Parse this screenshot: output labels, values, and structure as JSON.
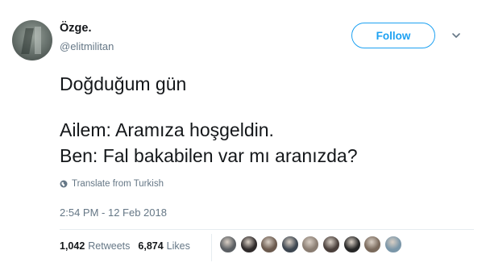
{
  "user": {
    "display_name": "Özge.",
    "handle": "@elitmilitan"
  },
  "follow_button": {
    "label": "Follow"
  },
  "tweet": {
    "lines": [
      "Doğduğum gün",
      "Ailem: Aramıza hoşgeldin.",
      "Ben: Fal bakabilen var mı aranızda?"
    ],
    "translate_label": "Translate from Turkish",
    "timestamp": "2:54 PM - 12 Feb 2018"
  },
  "stats": {
    "retweets_count": "1,042",
    "retweets_label": "Retweets",
    "likes_count": "6,874",
    "likes_label": "Likes"
  },
  "icons": {
    "more": "chevron-down-icon",
    "translate": "globe-icon"
  },
  "colors": {
    "accent": "#1da1f2",
    "secondary_text": "#657786",
    "primary_text": "#14171a",
    "divider": "#e6ecf0"
  },
  "liker_avatars": [
    {
      "color": "#5b5f63"
    },
    {
      "color": "#2f2a2a"
    },
    {
      "color": "#6b5a4e"
    },
    {
      "color": "#3d4650"
    },
    {
      "color": "#8a7d72"
    },
    {
      "color": "#4a3f3b"
    },
    {
      "color": "#262626"
    },
    {
      "color": "#7a6a5c"
    },
    {
      "color": "#7a96a8"
    }
  ]
}
